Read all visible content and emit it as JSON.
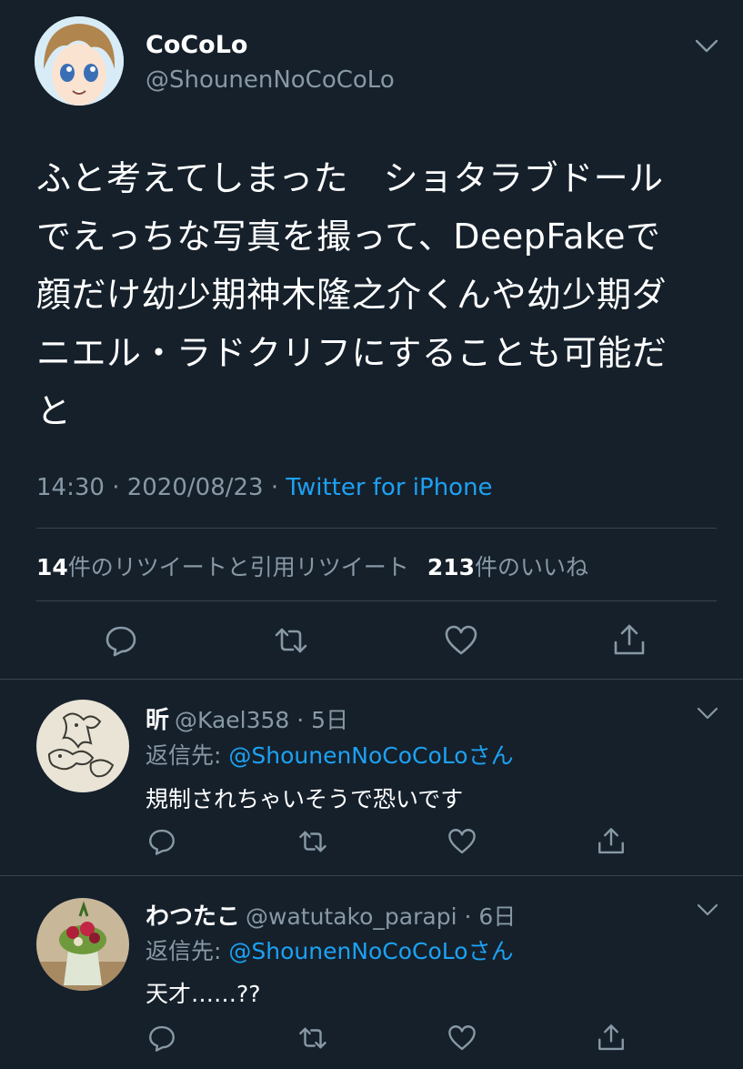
{
  "main_tweet": {
    "display_name": "CoCoLo",
    "handle": "@ShounenNoCoCoLo",
    "text_lines": [
      "ふと考えてしまった　ショタラブドール",
      "でえっちな写真を撮って、DeepFakeで",
      "顔だけ幼少期神木隆之介くんや幼少期ダ",
      "ニエル・ラドクリフにすることも可能だ",
      "と"
    ],
    "time": "14:30 · 2020/08/23 · ",
    "source": "Twitter for iPhone",
    "retweets_count": "14",
    "retweets_label": "件のリツイートと引用リツイート",
    "likes_count": "213",
    "likes_label": "件のいいね"
  },
  "replies": [
    {
      "name": "昕",
      "handle_time": "@Kael358 · 5日",
      "reply_to_prefix": "返信先: ",
      "reply_to_mention": "@ShounenNoCoCoLoさん",
      "text": "規制されちゃいそうで恐いです"
    },
    {
      "name": "わつたこ",
      "handle_time": "@watutako_parapi · 6日",
      "reply_to_prefix": "返信先: ",
      "reply_to_mention": "@ShounenNoCoCoLoさん",
      "text": "天才……??"
    }
  ],
  "colors": {
    "background": "#15202b",
    "text": "#ffffff",
    "secondary": "#8899a6",
    "accent": "#1da1f2",
    "divider": "#38444d"
  },
  "icons": [
    "chevron-down-icon",
    "reply-icon",
    "retweet-icon",
    "like-icon",
    "share-icon"
  ]
}
